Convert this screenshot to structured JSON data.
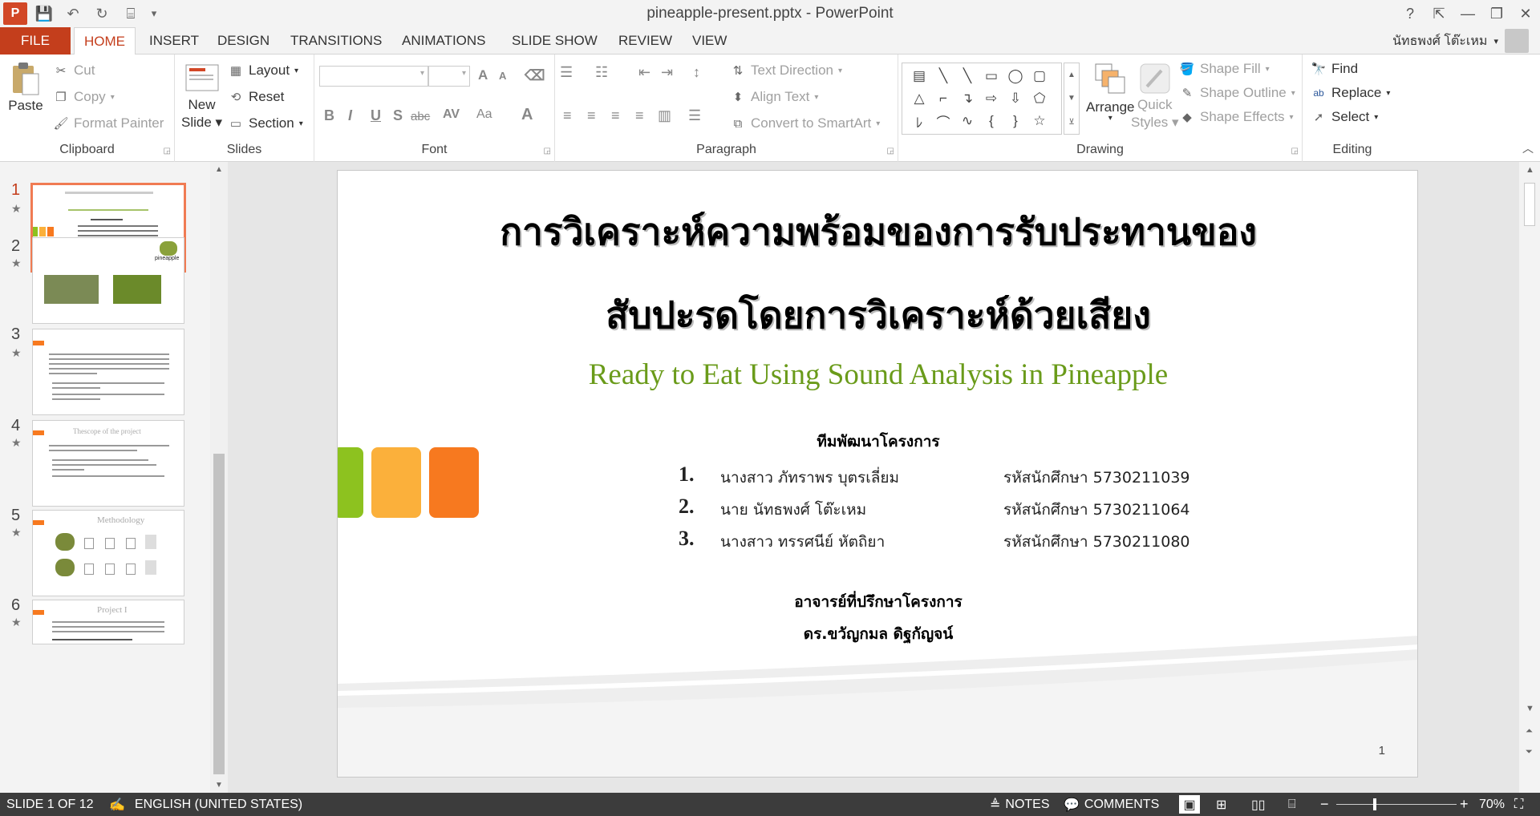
{
  "window": {
    "title": "pineapple-present.pptx - PowerPoint",
    "help": "?",
    "restore_ribbon": "⇱",
    "minimize": "—",
    "maximize": "❐",
    "close": "✕"
  },
  "qat": {
    "app_icon_label": "P",
    "save": "💾",
    "undo": "↶",
    "redo": "↻",
    "present": "⌸",
    "customize": "▾"
  },
  "tabs": {
    "file": "FILE",
    "home": "HOME",
    "insert": "INSERT",
    "design": "DESIGN",
    "transitions": "TRANSITIONS",
    "animations": "ANIMATIONS",
    "slide_show": "SLIDE SHOW",
    "review": "REVIEW",
    "view": "VIEW"
  },
  "user": {
    "name": "นัทธพงศ์ โต๊ะเหม",
    "arrow": "▾"
  },
  "clipboard": {
    "paste": "Paste",
    "cut": "Cut",
    "copy": "Copy",
    "format_painter": "Format Painter",
    "label": "Clipboard"
  },
  "slides": {
    "new_slide": "New",
    "new_slide2": "Slide",
    "layout": "Layout",
    "reset": "Reset",
    "section": "Section",
    "label": "Slides"
  },
  "font": {
    "label": "Font",
    "bold": "B",
    "italic": "I",
    "underline": "U",
    "shadow": "S",
    "strike": "abc",
    "spacing": "AV",
    "case": "Aa",
    "color": "A",
    "grow": "A",
    "shrink": "A"
  },
  "paragraph": {
    "label": "Paragraph",
    "text_direction": "Text Direction",
    "align_text": "Align Text",
    "smartart": "Convert to SmartArt"
  },
  "drawing": {
    "label": "Drawing",
    "arrange": "Arrange",
    "quick": "Quick",
    "styles": "Styles",
    "shape_fill": "Shape Fill",
    "shape_outline": "Shape Outline",
    "shape_effects": "Shape Effects",
    "shapes": [
      "▤",
      "╲",
      "╲",
      "▭",
      "◯",
      "▢",
      "△",
      "⌐",
      "↴",
      "⇨",
      "⇩",
      "⬠",
      "ﾚ",
      "⌒",
      "∿",
      "{",
      "}",
      "☆"
    ]
  },
  "editing": {
    "label": "Editing",
    "find": "Find",
    "replace": "Replace",
    "select": "Select"
  },
  "thumbnails": [
    {
      "num": "1",
      "star": "★"
    },
    {
      "num": "2",
      "star": "★",
      "logo": "pineapple"
    },
    {
      "num": "3",
      "star": "★"
    },
    {
      "num": "4",
      "star": "★",
      "title": "Thescope of the project"
    },
    {
      "num": "5",
      "star": "★",
      "title": "Methodology"
    },
    {
      "num": "6",
      "star": "★",
      "title": "Project I"
    }
  ],
  "slide": {
    "title_line1": "การวิเคราะห์ความพร้อมของการรับประทานของ",
    "title_line2": "สับปะรดโดยการวิเคราะห์ด้วยเสียง",
    "subtitle": "Ready to Eat Using Sound Analysis in Pineapple",
    "team_title": "ทีมพัฒนาโครงการ",
    "members": [
      {
        "num": "1.",
        "name": "นางสาว ภัทราพร บุตรเลี่ยม",
        "id": "รหัสนักศึกษา 5730211039"
      },
      {
        "num": "2.",
        "name": "นาย นัทธพงศ์ โต๊ะเหม",
        "id": "รหัสนักศึกษา 5730211064"
      },
      {
        "num": "3.",
        "name": "นางสาว ทรรศนีย์  หัตถิยา",
        "id": "รหัสนักศึกษา 5730211080"
      }
    ],
    "advisor_title": "อาจารย์ที่ปรึกษาโครงการ",
    "advisor_name": "ดร.ขวัญกมล ดิฐกัญจน์",
    "page_number": "1",
    "colors": {
      "green": "#8dc21f",
      "yellow": "#fbb03b",
      "orange": "#f7791f"
    }
  },
  "status": {
    "slide": "SLIDE 1 OF 12",
    "language": "ENGLISH (UNITED STATES)",
    "notes": "NOTES",
    "comments": "COMMENTS",
    "zoom": "70%",
    "minus": "−",
    "plus": "+"
  }
}
